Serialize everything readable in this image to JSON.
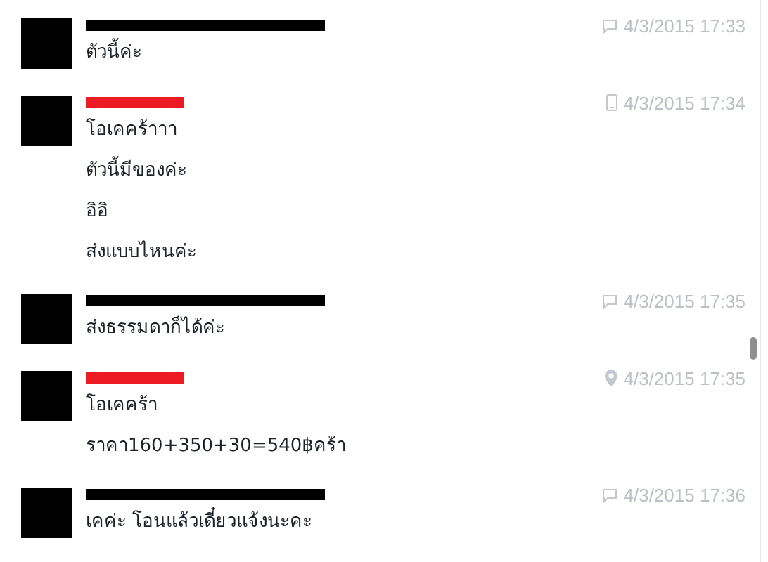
{
  "messages": [
    {
      "redaction": {
        "color": "#000000"
      },
      "kind": "web",
      "time": "4/3/2015 17:33",
      "lines": [
        "ตัวนี้ค่ะ"
      ]
    },
    {
      "redaction": {
        "color": "#ed1c24"
      },
      "kind": "mobile",
      "time": "4/3/2015 17:34",
      "lines": [
        "โอเคคร้าาา",
        "ตัวนี้มีของค่ะ",
        "อิอิ",
        "ส่งแบบไหนค่ะ"
      ]
    },
    {
      "redaction": {
        "color": "#000000"
      },
      "kind": "web",
      "time": "4/3/2015 17:35",
      "lines": [
        "ส่งธรรมดาก็ได้ค่ะ"
      ]
    },
    {
      "redaction": {
        "color": "#ed1c24"
      },
      "kind": "location",
      "time": "4/3/2015 17:35",
      "lines": [
        "โอเคคร้า",
        "ราคา160+350+30=540฿คร้า"
      ]
    },
    {
      "redaction": {
        "color": "#000000"
      },
      "kind": "web",
      "time": "4/3/2015 17:36",
      "lines": [
        "เคค่ะ โอนแล้วเดี๋ยวแจ้งนะคะ"
      ]
    }
  ]
}
